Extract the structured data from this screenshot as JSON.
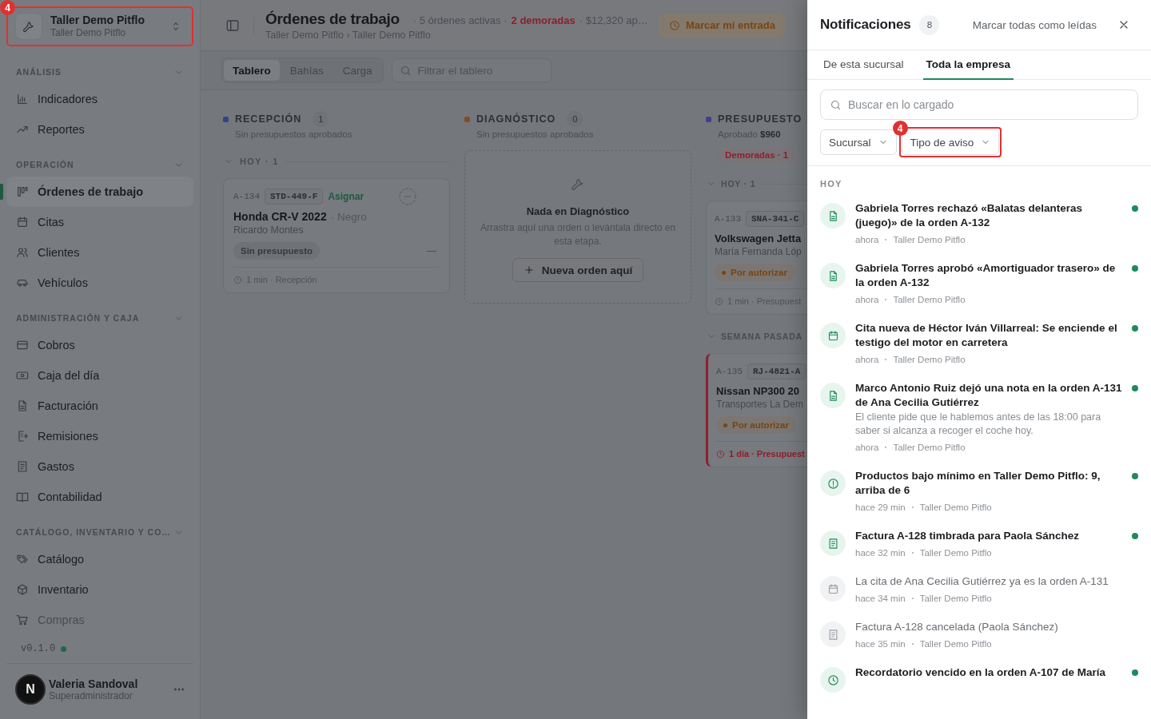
{
  "sidebar": {
    "workspace": {
      "name": "Taller Demo Pitflo",
      "subtitle": "Taller Demo Pitflo",
      "callout": "4"
    },
    "sections": [
      {
        "title": "ANÁLISIS",
        "expanded": true,
        "items": [
          {
            "label": "Indicadores",
            "kind": "chart",
            "selected": false
          },
          {
            "label": "Reportes",
            "kind": "trend",
            "selected": false
          }
        ]
      },
      {
        "title": "OPERACIÓN",
        "expanded": true,
        "items": [
          {
            "label": "Órdenes de trabajo",
            "kind": "kanban",
            "selected": true
          },
          {
            "label": "Citas",
            "kind": "calendar",
            "selected": false
          },
          {
            "label": "Clientes",
            "kind": "users",
            "selected": false
          },
          {
            "label": "Vehículos",
            "kind": "car",
            "selected": false
          }
        ]
      },
      {
        "title": "ADMINISTRACIÓN Y CAJA",
        "expanded": true,
        "items": [
          {
            "label": "Cobros",
            "kind": "card",
            "selected": false
          },
          {
            "label": "Caja del día",
            "kind": "cash",
            "selected": false
          },
          {
            "label": "Facturación",
            "kind": "doc",
            "selected": false
          },
          {
            "label": "Remisiones",
            "kind": "export",
            "selected": false
          },
          {
            "label": "Gastos",
            "kind": "receipt",
            "selected": false
          },
          {
            "label": "Contabilidad",
            "kind": "book",
            "selected": false
          }
        ]
      },
      {
        "title": "CATÁLOGO, INVENTARIO Y CO…",
        "expanded": true,
        "items": [
          {
            "label": "Catálogo",
            "kind": "tag",
            "selected": false
          },
          {
            "label": "Inventario",
            "kind": "box",
            "selected": false
          },
          {
            "label": "Compras",
            "kind": "cart",
            "selected": false
          }
        ]
      }
    ],
    "version": "v0.1.0",
    "online": true,
    "user": {
      "initial": "N",
      "name": "Valeria Sandoval",
      "role": "Superadministrador"
    }
  },
  "header": {
    "title": "Órdenes de trabajo",
    "stats": [
      {
        "text": "· 5 órdenes activas ·",
        "alert": false
      },
      {
        "text": "2 demoradas",
        "alert": true
      },
      {
        "text": "· $12,320 ap…",
        "alert": false
      }
    ],
    "breadcrumb": "Taller Demo Pitflo › Taller Demo Pitflo",
    "button": "Marcar mi entrada"
  },
  "toolbar": {
    "tabs": [
      {
        "label": "Tablero",
        "selected": true
      },
      {
        "label": "Bahías",
        "selected": false
      },
      {
        "label": "Carga",
        "selected": false
      }
    ],
    "filter": {
      "placeholder": "Filtrar el tablero"
    }
  },
  "board": {
    "columns": [
      {
        "title": "RECEPCIÓN",
        "color": "#2f4689",
        "count": "1",
        "subtitle": "Sin presupuestos aprobados",
        "groups": [
          {
            "label": "HOY · 1",
            "expanded": true,
            "cards": [
              {
                "order": "A-134",
                "plate": "STD-449-F",
                "assign": "Asignar",
                "vehicle": "Honda CR-V 2022",
                "color_name": "· Negro",
                "customer": "Ricardo Montes",
                "status": {
                  "label": "Sin presupuesto",
                  "kind": "neutral"
                },
                "amount": "—",
                "footer": "1 min · Recepción",
                "overdue": false
              }
            ]
          }
        ]
      },
      {
        "title": "DIAGNÓSTICO",
        "color": "#874a22",
        "count": "0",
        "subtitle": "Sin presupuestos aprobados",
        "empty": {
          "title": "Nada en Diagnóstico",
          "text": "Arrastra aquí una orden o levántala directo en esta etapa.",
          "button": "Nueva orden aquí"
        }
      },
      {
        "title": "PRESUPUESTO",
        "color": "#4b3a8a",
        "subtitle": "Aprobado **$960**",
        "delayed": "Demoradas · 1",
        "groups": [
          {
            "label": "HOY · 1",
            "expanded": true,
            "cards": [
              {
                "order": "A-133",
                "plate": "SNA-341-C",
                "vehicle": "Volkswagen Jetta",
                "customer": "María Fernanda Lóp",
                "status": {
                  "label": "Por autorizar",
                  "kind": "warning"
                },
                "footer": "1 min · Presupuest",
                "overdue": false
              }
            ]
          },
          {
            "label": "SEMANA PASADA",
            "expanded": true,
            "cards": [
              {
                "order": "A-135",
                "plate": "RJ-4821-A",
                "vehicle": "Nissan NP300 20",
                "customer": "Transportes La Dem",
                "status": {
                  "label": "Por autorizar",
                  "kind": "warning"
                },
                "footer": "1 día · Presupuest",
                "overdue": true
              }
            ]
          }
        ]
      }
    ]
  },
  "notifications": {
    "title": "Notificaciones",
    "count": "8",
    "mark_all": "Marcar todas como leídas",
    "tabs": [
      {
        "label": "De esta sucursal",
        "selected": false
      },
      {
        "label": "Toda la empresa",
        "selected": true
      }
    ],
    "search": {
      "placeholder": "Buscar en lo cargado"
    },
    "filters": [
      {
        "label": "Sucursal"
      },
      {
        "label": "Tipo de aviso",
        "callout": "4"
      }
    ],
    "group": "HOY",
    "items": [
      {
        "kind": "doc",
        "title": "Gabriela Torres rechazó «Balatas delanteras (juego)» de la orden A-132",
        "time": "ahora",
        "branch": "Taller Demo Pitflo",
        "unread": true
      },
      {
        "kind": "doc",
        "title": "Gabriela Torres aprobó «Amortiguador trasero» de la orden A-132",
        "time": "ahora",
        "branch": "Taller Demo Pitflo",
        "unread": true
      },
      {
        "kind": "calendar",
        "title": "Cita nueva de Héctor Iván Villarreal: Se enciende el testigo del motor en carretera",
        "time": "ahora",
        "branch": "Taller Demo Pitflo",
        "unread": true
      },
      {
        "kind": "doc",
        "title": "Marco Antonio Ruiz dejó una nota en la orden A-131 de Ana Cecilia Gutiérrez",
        "body": "El cliente pide que le hablemos antes de las 18:00 para saber si alcanza a recoger el coche hoy.",
        "time": "ahora",
        "branch": "Taller Demo Pitflo",
        "unread": true
      },
      {
        "kind": "alert",
        "title": "Productos bajo mínimo en Taller Demo Pitflo: 9, arriba de 6",
        "time": "hace 29 min",
        "branch": "Taller Demo Pitflo",
        "unread": true
      },
      {
        "kind": "receipt",
        "title": "Factura A-128 timbrada para Paola Sánchez",
        "time": "hace 32 min",
        "branch": "Taller Demo Pitflo",
        "unread": true
      },
      {
        "kind": "calendar",
        "title": "La cita de Ana Cecilia Gutiérrez ya es la orden A-131",
        "time": "hace 34 min",
        "branch": "Taller Demo Pitflo",
        "unread": false
      },
      {
        "kind": "receipt",
        "title": "Factura A-128 cancelada (Paola Sánchez)",
        "time": "hace 35 min",
        "branch": "Taller Demo Pitflo",
        "unread": false
      },
      {
        "kind": "clock",
        "title": "Recordatorio vencido en la orden A-107 de María",
        "unread": true
      }
    ]
  }
}
